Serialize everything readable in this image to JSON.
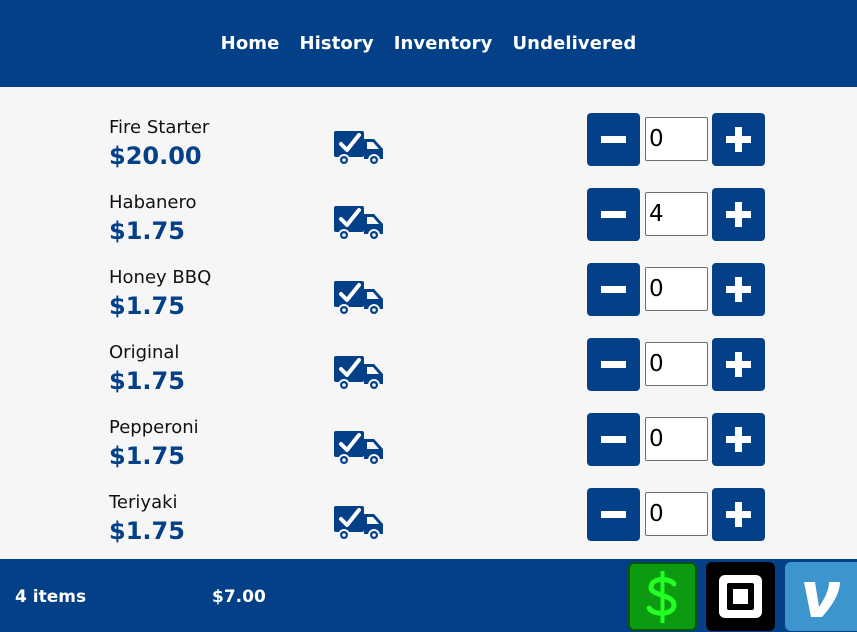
{
  "nav": {
    "items": [
      {
        "label": "Home"
      },
      {
        "label": "History"
      },
      {
        "label": "Inventory"
      },
      {
        "label": "Undelivered"
      }
    ]
  },
  "products": [
    {
      "name": "Fire Starter",
      "price": "$20.00",
      "qty": "0"
    },
    {
      "name": "Habanero",
      "price": "$1.75",
      "qty": "4"
    },
    {
      "name": "Honey BBQ",
      "price": "$1.75",
      "qty": "0"
    },
    {
      "name": "Original",
      "price": "$1.75",
      "qty": "0"
    },
    {
      "name": "Pepperoni",
      "price": "$1.75",
      "qty": "0"
    },
    {
      "name": "Teriyaki",
      "price": "$1.75",
      "qty": "0"
    }
  ],
  "icons": {
    "delivery": "truck-check-icon",
    "decrement": "minus-icon",
    "increment": "plus-icon",
    "cash": "dollar-icon",
    "square": "square-icon",
    "venmo": "venmo-icon"
  },
  "footer": {
    "item_count": "4 items",
    "total": "$7.00"
  },
  "colors": {
    "primary": "#034088",
    "cash": "#0c9a10",
    "cash_symbol": "#22ff22",
    "square": "#000000",
    "venmo": "#3d95ce"
  }
}
